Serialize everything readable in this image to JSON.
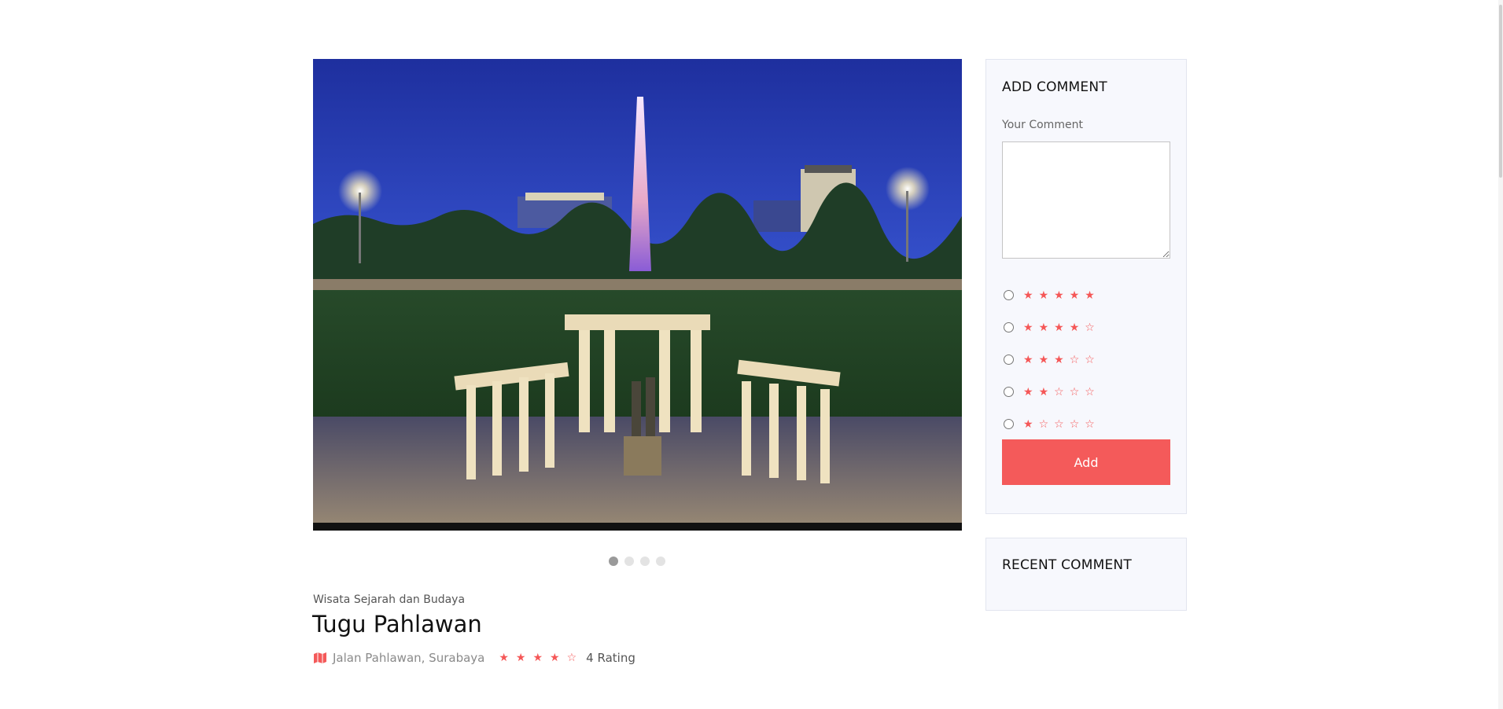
{
  "hero": {
    "image_alt": "Tugu Pahlawan at night"
  },
  "carousel": {
    "dots": 4,
    "active_index": 0
  },
  "place": {
    "category": "Wisata Sejarah dan Budaya",
    "title": "Tugu Pahlawan",
    "address": "Jalan Pahlawan, Surabaya",
    "rating_stars": 4,
    "rating_max": 5,
    "rating_label": "4 Rating"
  },
  "add_comment": {
    "heading": "ADD COMMENT",
    "comment_label": "Your Comment",
    "comment_value": "",
    "rating_options": [
      5,
      4,
      3,
      2,
      1
    ],
    "add_button": "Add"
  },
  "recent_comment": {
    "heading": "RECENT COMMENT"
  },
  "colors": {
    "accent": "#f45a5a",
    "panel_bg": "#f7f8fd"
  }
}
